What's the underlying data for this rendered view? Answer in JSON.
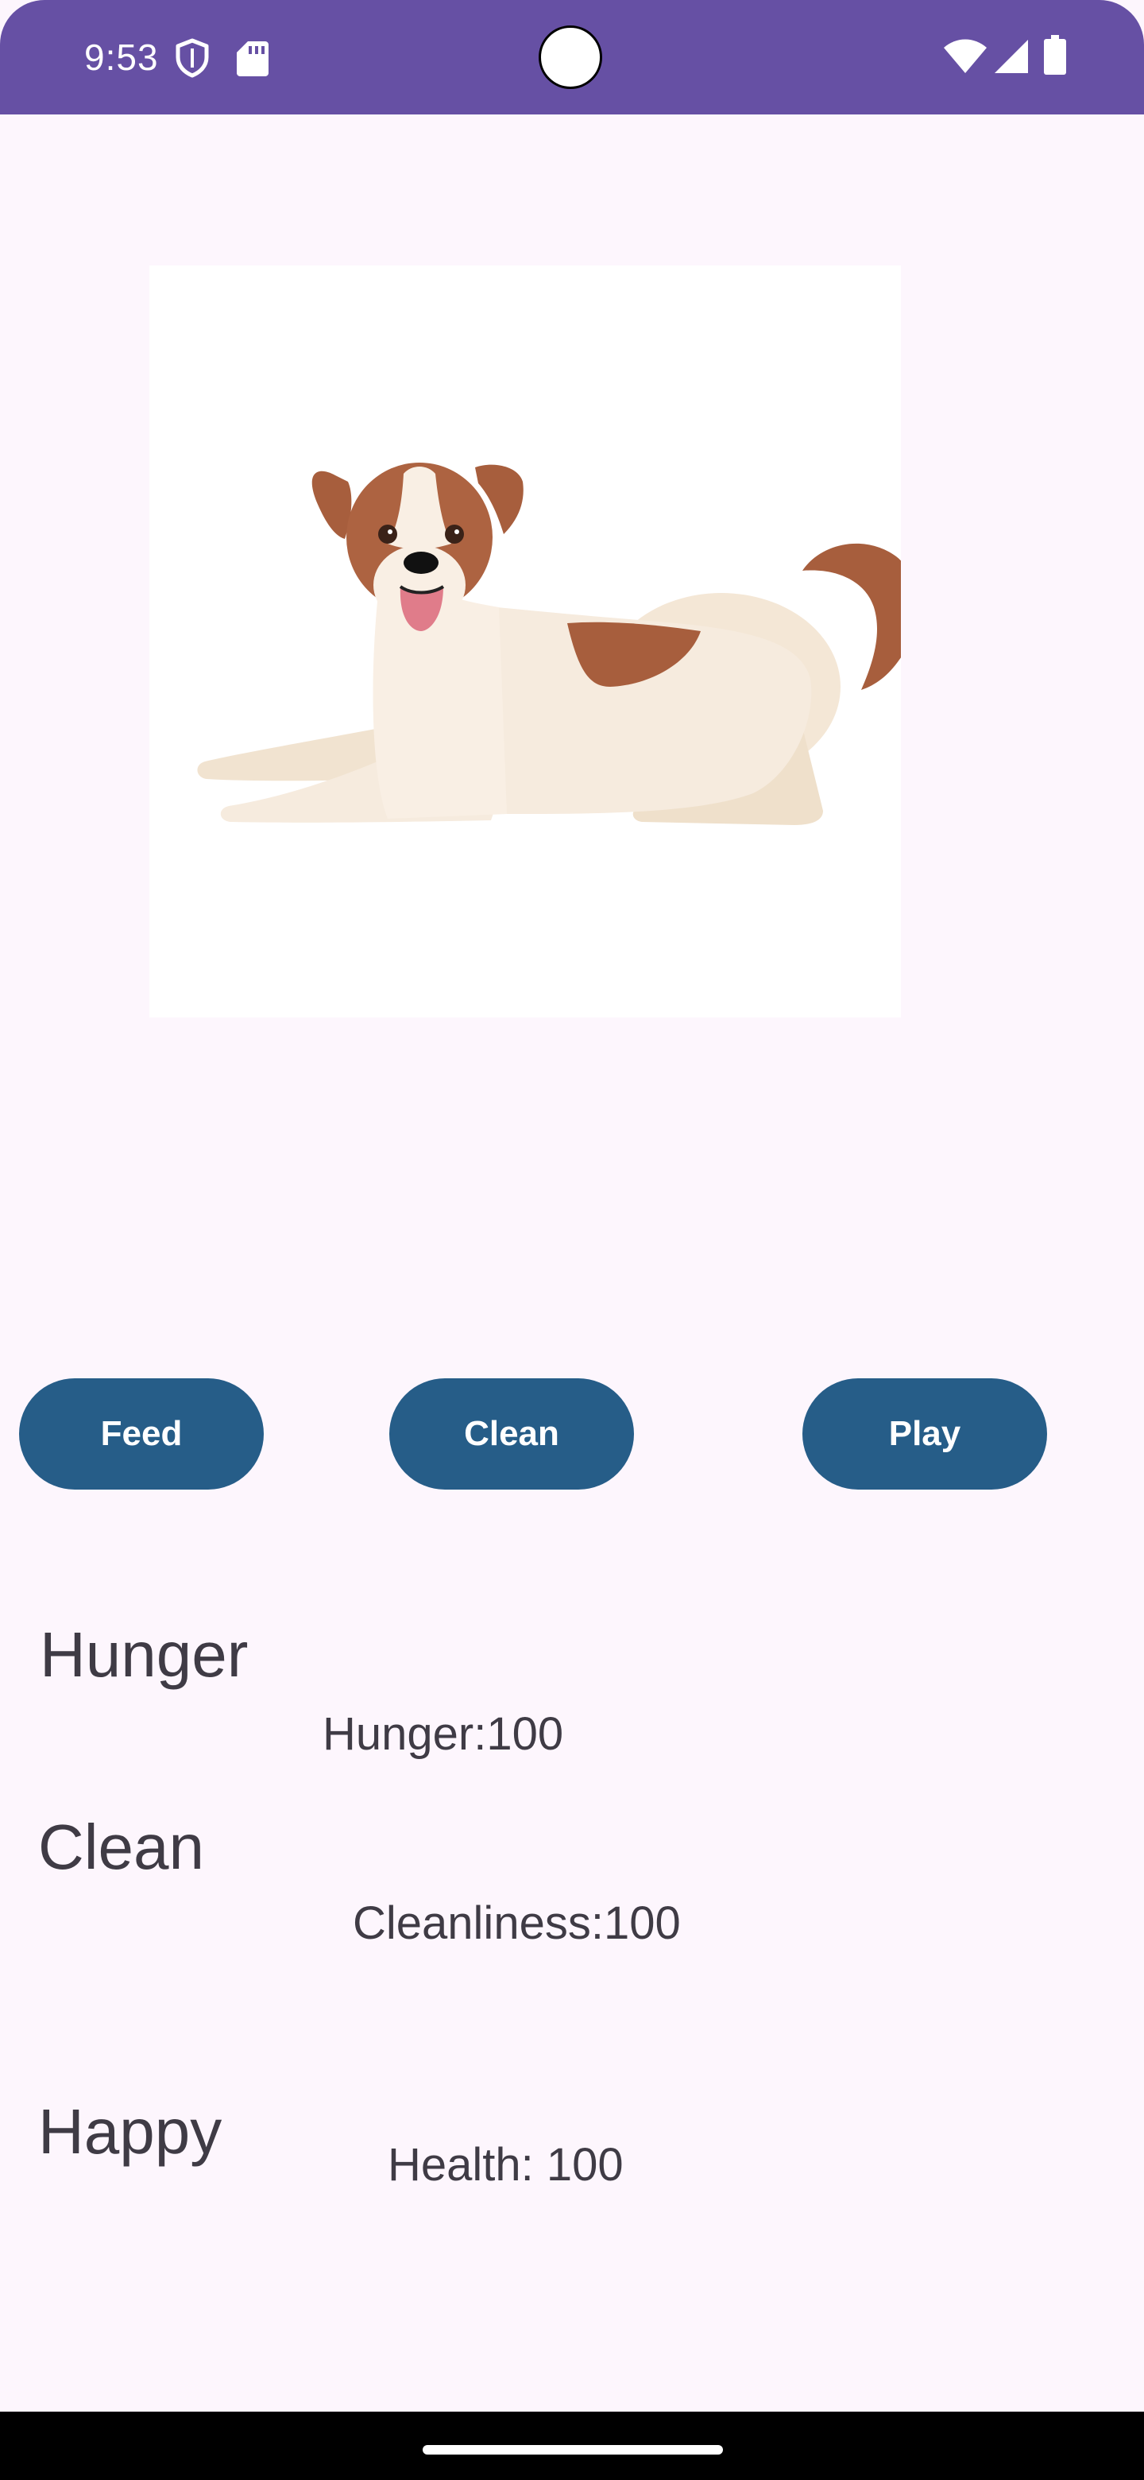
{
  "status_bar": {
    "time": "9:53",
    "icons_left": [
      "shield-icon",
      "sd-card-icon"
    ],
    "icons_right": [
      "wifi-icon",
      "signal-icon",
      "battery-icon"
    ],
    "background_color": "#6650a4"
  },
  "pet": {
    "image": "dog-illustration"
  },
  "actions": {
    "feed_label": "Feed",
    "clean_label": "Clean",
    "play_label": "Play",
    "button_color": "#265d88"
  },
  "stats": {
    "hunger": {
      "label": "Hunger",
      "value_text": "Hunger:100"
    },
    "clean": {
      "label": "Clean",
      "value_text": "Cleanliness:100"
    },
    "happy": {
      "label": "Happy",
      "value_text": "Health: 100"
    }
  }
}
